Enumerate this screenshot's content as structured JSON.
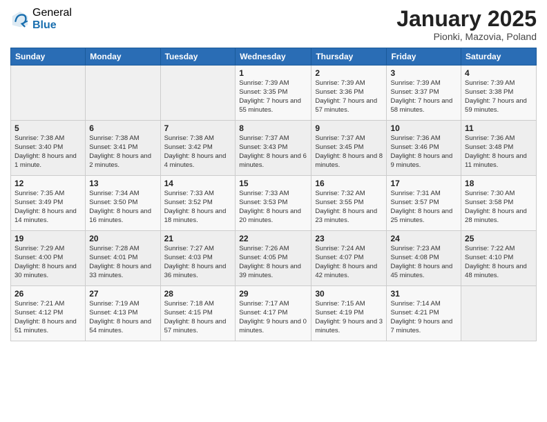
{
  "logo": {
    "general": "General",
    "blue": "Blue"
  },
  "header": {
    "title": "January 2025",
    "subtitle": "Pionki, Mazovia, Poland"
  },
  "weekdays": [
    "Sunday",
    "Monday",
    "Tuesday",
    "Wednesday",
    "Thursday",
    "Friday",
    "Saturday"
  ],
  "weeks": [
    [
      {
        "day": "",
        "sunrise": "",
        "sunset": "",
        "daylight": ""
      },
      {
        "day": "",
        "sunrise": "",
        "sunset": "",
        "daylight": ""
      },
      {
        "day": "",
        "sunrise": "",
        "sunset": "",
        "daylight": ""
      },
      {
        "day": "1",
        "sunrise": "Sunrise: 7:39 AM",
        "sunset": "Sunset: 3:35 PM",
        "daylight": "Daylight: 7 hours and 55 minutes."
      },
      {
        "day": "2",
        "sunrise": "Sunrise: 7:39 AM",
        "sunset": "Sunset: 3:36 PM",
        "daylight": "Daylight: 7 hours and 57 minutes."
      },
      {
        "day": "3",
        "sunrise": "Sunrise: 7:39 AM",
        "sunset": "Sunset: 3:37 PM",
        "daylight": "Daylight: 7 hours and 58 minutes."
      },
      {
        "day": "4",
        "sunrise": "Sunrise: 7:39 AM",
        "sunset": "Sunset: 3:38 PM",
        "daylight": "Daylight: 7 hours and 59 minutes."
      }
    ],
    [
      {
        "day": "5",
        "sunrise": "Sunrise: 7:38 AM",
        "sunset": "Sunset: 3:40 PM",
        "daylight": "Daylight: 8 hours and 1 minute."
      },
      {
        "day": "6",
        "sunrise": "Sunrise: 7:38 AM",
        "sunset": "Sunset: 3:41 PM",
        "daylight": "Daylight: 8 hours and 2 minutes."
      },
      {
        "day": "7",
        "sunrise": "Sunrise: 7:38 AM",
        "sunset": "Sunset: 3:42 PM",
        "daylight": "Daylight: 8 hours and 4 minutes."
      },
      {
        "day": "8",
        "sunrise": "Sunrise: 7:37 AM",
        "sunset": "Sunset: 3:43 PM",
        "daylight": "Daylight: 8 hours and 6 minutes."
      },
      {
        "day": "9",
        "sunrise": "Sunrise: 7:37 AM",
        "sunset": "Sunset: 3:45 PM",
        "daylight": "Daylight: 8 hours and 8 minutes."
      },
      {
        "day": "10",
        "sunrise": "Sunrise: 7:36 AM",
        "sunset": "Sunset: 3:46 PM",
        "daylight": "Daylight: 8 hours and 9 minutes."
      },
      {
        "day": "11",
        "sunrise": "Sunrise: 7:36 AM",
        "sunset": "Sunset: 3:48 PM",
        "daylight": "Daylight: 8 hours and 11 minutes."
      }
    ],
    [
      {
        "day": "12",
        "sunrise": "Sunrise: 7:35 AM",
        "sunset": "Sunset: 3:49 PM",
        "daylight": "Daylight: 8 hours and 14 minutes."
      },
      {
        "day": "13",
        "sunrise": "Sunrise: 7:34 AM",
        "sunset": "Sunset: 3:50 PM",
        "daylight": "Daylight: 8 hours and 16 minutes."
      },
      {
        "day": "14",
        "sunrise": "Sunrise: 7:33 AM",
        "sunset": "Sunset: 3:52 PM",
        "daylight": "Daylight: 8 hours and 18 minutes."
      },
      {
        "day": "15",
        "sunrise": "Sunrise: 7:33 AM",
        "sunset": "Sunset: 3:53 PM",
        "daylight": "Daylight: 8 hours and 20 minutes."
      },
      {
        "day": "16",
        "sunrise": "Sunrise: 7:32 AM",
        "sunset": "Sunset: 3:55 PM",
        "daylight": "Daylight: 8 hours and 23 minutes."
      },
      {
        "day": "17",
        "sunrise": "Sunrise: 7:31 AM",
        "sunset": "Sunset: 3:57 PM",
        "daylight": "Daylight: 8 hours and 25 minutes."
      },
      {
        "day": "18",
        "sunrise": "Sunrise: 7:30 AM",
        "sunset": "Sunset: 3:58 PM",
        "daylight": "Daylight: 8 hours and 28 minutes."
      }
    ],
    [
      {
        "day": "19",
        "sunrise": "Sunrise: 7:29 AM",
        "sunset": "Sunset: 4:00 PM",
        "daylight": "Daylight: 8 hours and 30 minutes."
      },
      {
        "day": "20",
        "sunrise": "Sunrise: 7:28 AM",
        "sunset": "Sunset: 4:01 PM",
        "daylight": "Daylight: 8 hours and 33 minutes."
      },
      {
        "day": "21",
        "sunrise": "Sunrise: 7:27 AM",
        "sunset": "Sunset: 4:03 PM",
        "daylight": "Daylight: 8 hours and 36 minutes."
      },
      {
        "day": "22",
        "sunrise": "Sunrise: 7:26 AM",
        "sunset": "Sunset: 4:05 PM",
        "daylight": "Daylight: 8 hours and 39 minutes."
      },
      {
        "day": "23",
        "sunrise": "Sunrise: 7:24 AM",
        "sunset": "Sunset: 4:07 PM",
        "daylight": "Daylight: 8 hours and 42 minutes."
      },
      {
        "day": "24",
        "sunrise": "Sunrise: 7:23 AM",
        "sunset": "Sunset: 4:08 PM",
        "daylight": "Daylight: 8 hours and 45 minutes."
      },
      {
        "day": "25",
        "sunrise": "Sunrise: 7:22 AM",
        "sunset": "Sunset: 4:10 PM",
        "daylight": "Daylight: 8 hours and 48 minutes."
      }
    ],
    [
      {
        "day": "26",
        "sunrise": "Sunrise: 7:21 AM",
        "sunset": "Sunset: 4:12 PM",
        "daylight": "Daylight: 8 hours and 51 minutes."
      },
      {
        "day": "27",
        "sunrise": "Sunrise: 7:19 AM",
        "sunset": "Sunset: 4:13 PM",
        "daylight": "Daylight: 8 hours and 54 minutes."
      },
      {
        "day": "28",
        "sunrise": "Sunrise: 7:18 AM",
        "sunset": "Sunset: 4:15 PM",
        "daylight": "Daylight: 8 hours and 57 minutes."
      },
      {
        "day": "29",
        "sunrise": "Sunrise: 7:17 AM",
        "sunset": "Sunset: 4:17 PM",
        "daylight": "Daylight: 9 hours and 0 minutes."
      },
      {
        "day": "30",
        "sunrise": "Sunrise: 7:15 AM",
        "sunset": "Sunset: 4:19 PM",
        "daylight": "Daylight: 9 hours and 3 minutes."
      },
      {
        "day": "31",
        "sunrise": "Sunrise: 7:14 AM",
        "sunset": "Sunset: 4:21 PM",
        "daylight": "Daylight: 9 hours and 7 minutes."
      },
      {
        "day": "",
        "sunrise": "",
        "sunset": "",
        "daylight": ""
      }
    ]
  ]
}
